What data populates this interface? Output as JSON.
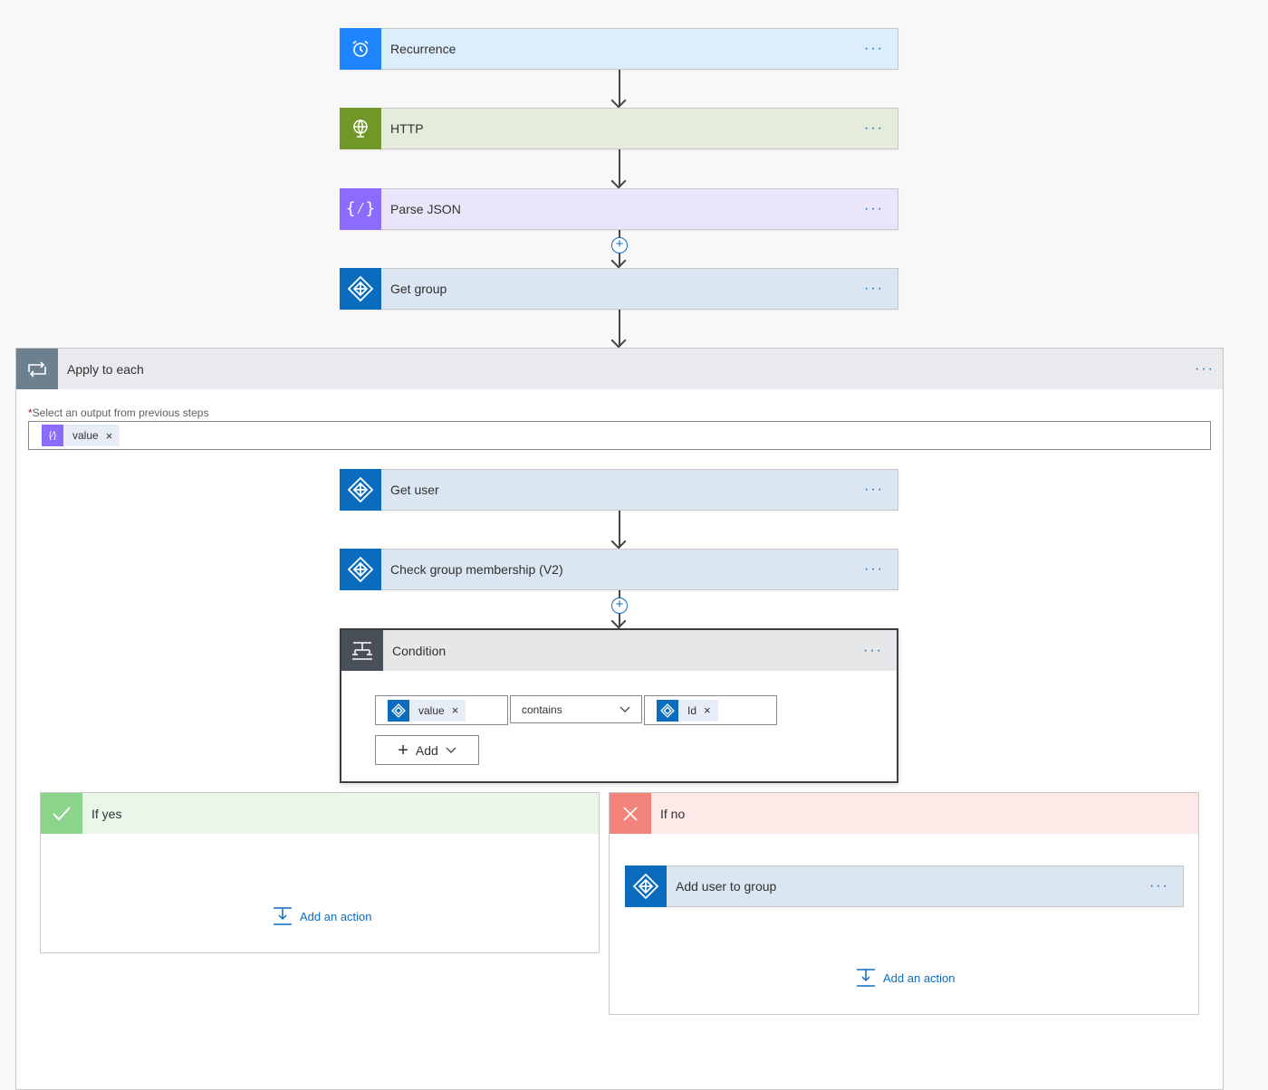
{
  "steps": {
    "recurrence": {
      "label": "Recurrence",
      "more": "···"
    },
    "http": {
      "label": "HTTP",
      "more": "···"
    },
    "parse_json": {
      "label": "Parse JSON",
      "more": "···"
    },
    "get_group": {
      "label": "Get group",
      "more": "···"
    }
  },
  "apply_to_each": {
    "title": "Apply to each",
    "more": "···",
    "required_marker": "*",
    "field_label": "Select an output from previous steps",
    "token": {
      "label": "value",
      "remove": "×"
    }
  },
  "inner_steps": {
    "get_user": {
      "label": "Get user",
      "more": "···"
    },
    "check_membership": {
      "label": "Check group membership (V2)",
      "more": "···"
    }
  },
  "condition": {
    "title": "Condition",
    "more": "···",
    "left_token": {
      "label": "value",
      "remove": "×"
    },
    "operator": "contains",
    "right_token": {
      "label": "Id",
      "remove": "×"
    },
    "add_label": "Add"
  },
  "if_yes": {
    "title": "If yes",
    "add_action": "Add an action"
  },
  "if_no": {
    "title": "If no",
    "step": {
      "label": "Add user to group",
      "more": "···"
    },
    "add_action": "Add an action"
  },
  "colors": {
    "recurrence": "#1f85ff",
    "http": "#709727",
    "parse_json": "#8c6cff",
    "azure_ad": "#0b6cbd",
    "yes": "#8ad48c",
    "no": "#f2837b"
  }
}
